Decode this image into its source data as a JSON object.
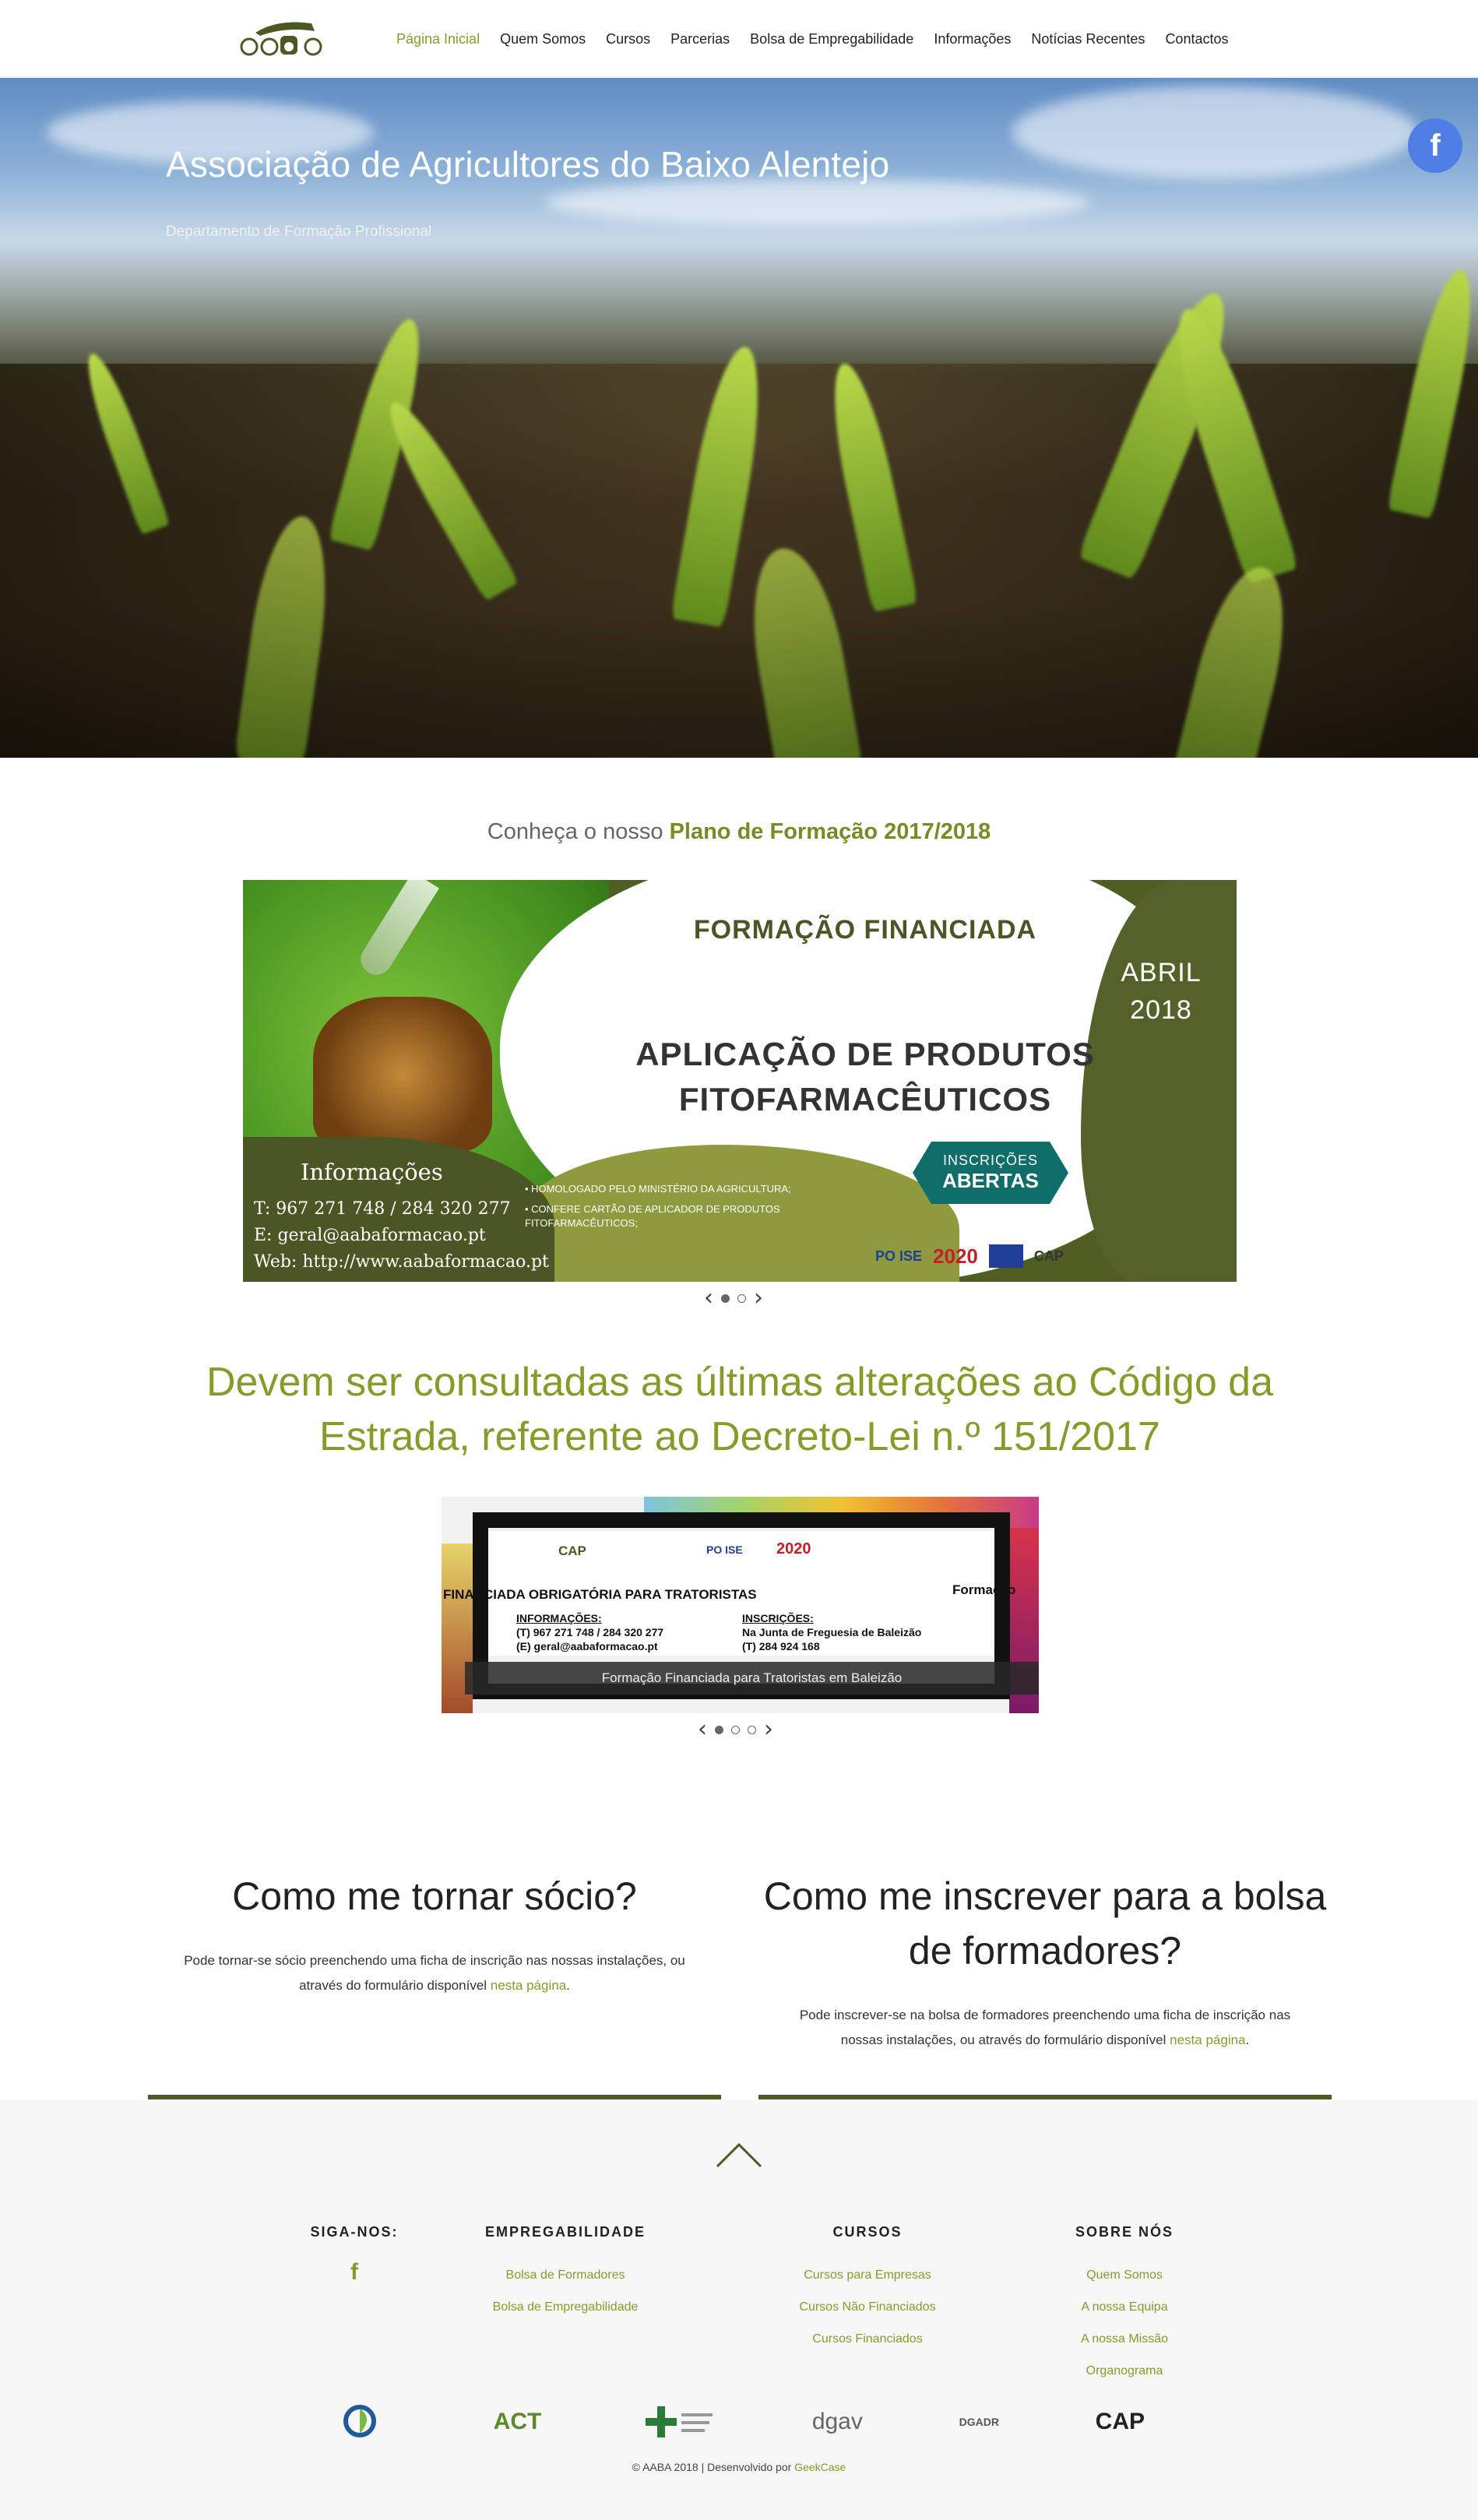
{
  "nav": {
    "items": [
      {
        "label": "Página Inicial",
        "active": true
      },
      {
        "label": "Quem Somos",
        "active": false
      },
      {
        "label": "Cursos",
        "active": false
      },
      {
        "label": "Parcerias",
        "active": false
      },
      {
        "label": "Bolsa de Empregabilidade",
        "active": false
      },
      {
        "label": "Informações",
        "active": false
      },
      {
        "label": "Notícias Recentes",
        "active": false
      },
      {
        "label": "Contactos",
        "active": false
      }
    ]
  },
  "hero": {
    "title": "Associação de Agricultores do Baixo Alentejo",
    "subtitle": "Departamento de Formação Profissional",
    "facebook_icon": "facebook-icon"
  },
  "plan": {
    "heading_prefix": "Conheça o nosso",
    "heading_bold": "Plano de Formação 2017/2018"
  },
  "banner": {
    "title": "FORMAÇÃO FINANCIADA",
    "month": "ABRIL",
    "year": "2018",
    "course_line1": "APLICAÇÃO DE PRODUTOS",
    "course_line2": "FITOFARMACÊUTICOS",
    "info_title": "Informações",
    "phone": "T: 967 271 748  / 284 320 277",
    "email": "E: geral@aabaformacao.pt",
    "web": "Web: http://www.aabaformacao.pt",
    "bullet1": "• HOMOLOGADO PELO MINISTÉRIO DA AGRICULTURA;",
    "bullet2": "• CONFERE CARTÃO DE APLICADOR DE PRODUTOS FITOFARMACÊUTICOS;",
    "badge_line1": "INSCRIÇÕES",
    "badge_line2": "ABERTAS",
    "logo_poise": "PO ISE",
    "logo_portugal": "2020",
    "logo_cap": "CAP"
  },
  "carousel1": {
    "dots": 2,
    "active": 0
  },
  "news": {
    "title": "Devem ser consultadas as últimas alterações ao Código da Estrada, referente ao Decreto-Lei n.º 151/2017",
    "caption": "Formação Financiada para Tratoristas em Baleizão",
    "doc_heading": "FINANCIADA OBRIGATÓRIA  PARA  TRATORISTAS",
    "doc_info_label": "INFORMAÇÕES:",
    "doc_info_phone": "(T) 967 271 748  / 284 320 277",
    "doc_info_email": "(E) geral@aabaformacao.pt",
    "doc_insc_label": "INSCRIÇÕES:",
    "doc_insc_place": "Na Junta de Freguesia de Baleizão",
    "doc_insc_phone": "(T) 284 924 168",
    "doc_side": "Formação",
    "doc_logo_cap": "CAP",
    "doc_logo_poise": "PO ISE",
    "doc_logo_2020": "2020"
  },
  "carousel2": {
    "dots": 3,
    "active": 0
  },
  "socio": {
    "title": "Como me tornar sócio?",
    "text": "Pode tornar-se sócio preenchendo uma ficha de inscrição nas nossas instalações, ou através do formulário disponível",
    "link": "nesta página",
    "end": "."
  },
  "bolsa": {
    "title": "Como me inscrever para a bolsa de formadores?",
    "text": "Pode inscrever-se na bolsa de formadores preenchendo uma ficha de inscrição nas nossas instalações, ou através do formulário disponível",
    "link": "nesta página",
    "end": "."
  },
  "footer": {
    "siga": {
      "title": "SIGA-NOS:",
      "icon": "facebook-icon"
    },
    "empregabilidade": {
      "title": "EMPREGABILIDADE",
      "links": [
        "Bolsa de Formadores",
        "Bolsa de Empregabilidade"
      ]
    },
    "cursos": {
      "title": "CURSOS",
      "links": [
        "Cursos para Empresas",
        "Cursos Não Financiados",
        "Cursos Financiados"
      ]
    },
    "sobre": {
      "title": "SOBRE NÓS",
      "links": [
        "Quem Somos",
        "A nossa Equipa",
        "A nossa Missão",
        "Organograma"
      ]
    },
    "partners": [
      "ACT",
      "dgav",
      "DGADR",
      "CAP"
    ],
    "copyright": "© AABA 2018 | Desenvolvido por",
    "developer": "GeekCase"
  },
  "colors": {
    "accent": "#8a9a2a",
    "dark_olive": "#4a5a22",
    "facebook": "#4d7fe4"
  }
}
